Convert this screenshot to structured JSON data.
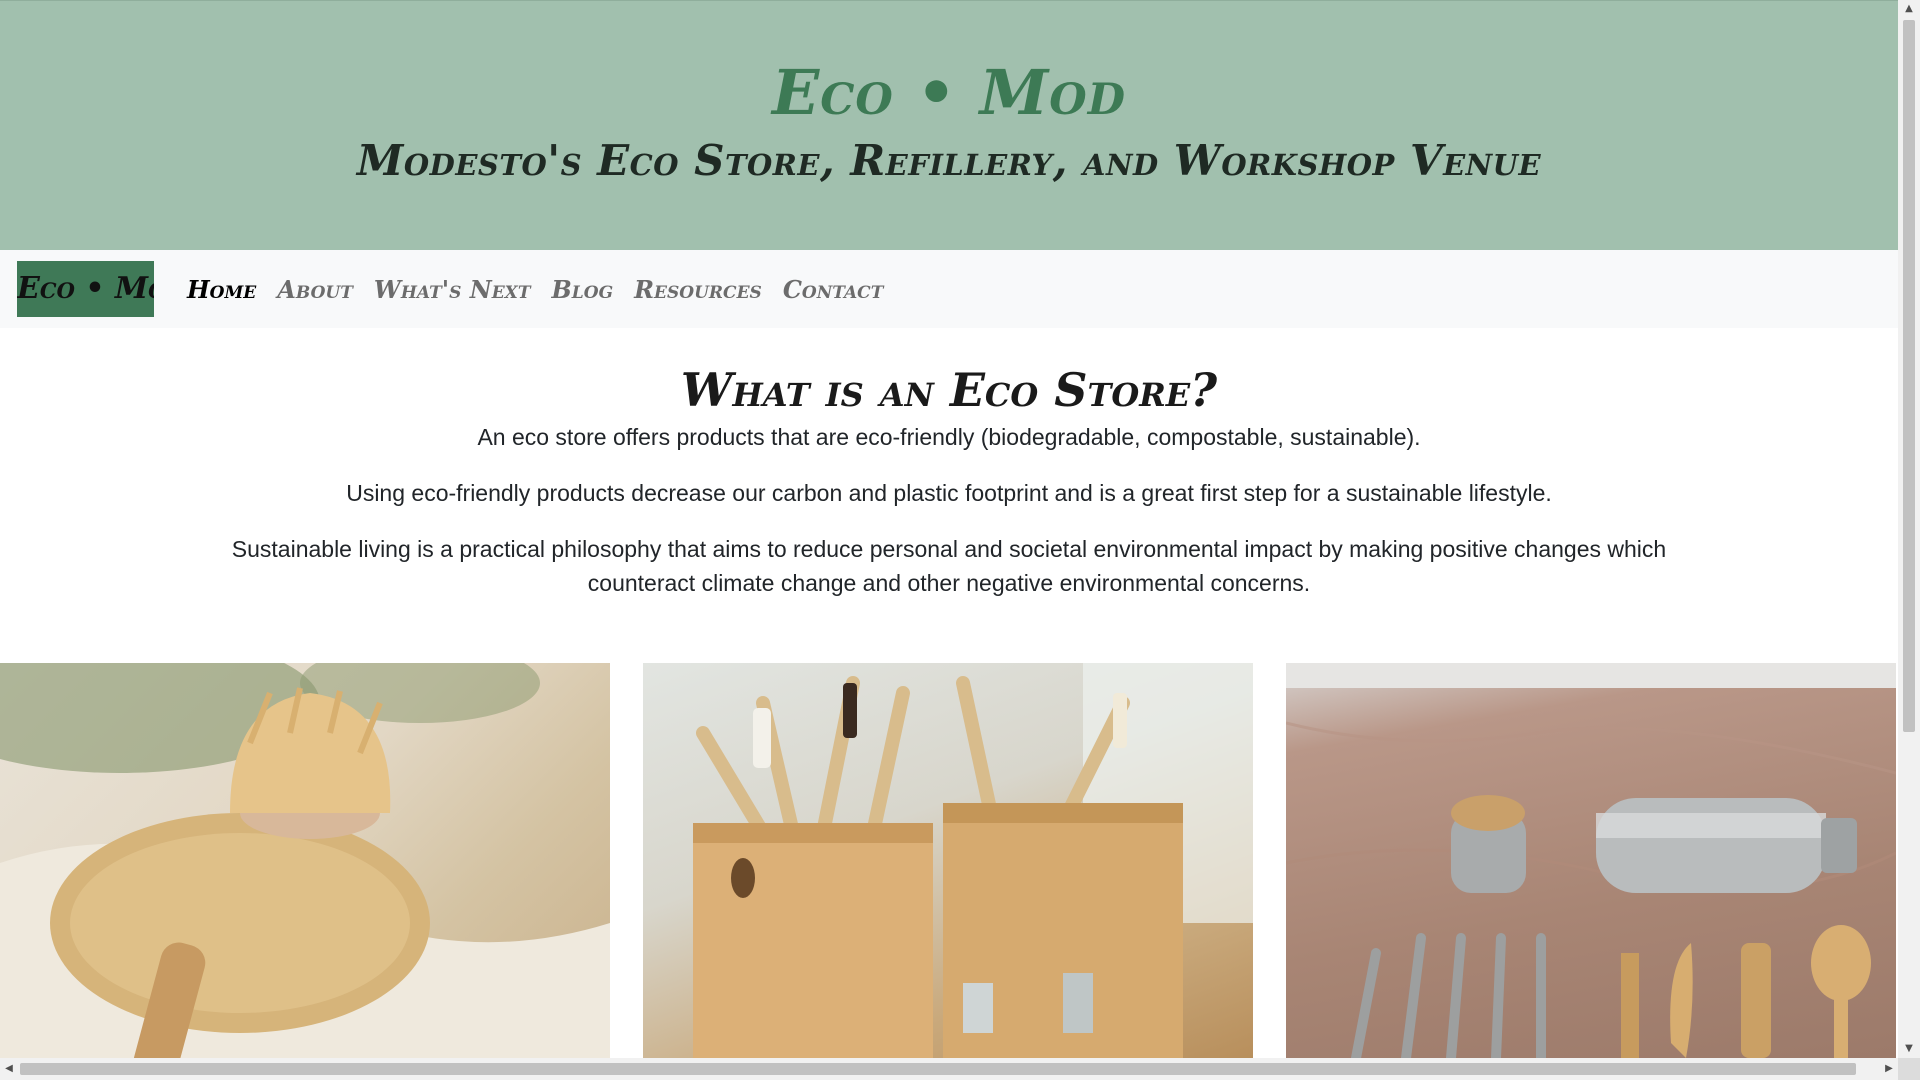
{
  "hero": {
    "title": "Eco • Mod",
    "subtitle": "Modesto's Eco Store, Refillery, and Workshop Venue"
  },
  "navbar": {
    "brand": "Eco • Mod",
    "links": [
      {
        "label": "Home",
        "active": true
      },
      {
        "label": "About"
      },
      {
        "label": "What's Next"
      },
      {
        "label": "Blog"
      },
      {
        "label": "Resources"
      },
      {
        "label": "Contact"
      }
    ]
  },
  "content": {
    "heading": "What is an Eco Store?",
    "paragraphs": [
      "An eco store offers products that are eco-friendly (biodegradable, compostable, sustainable).",
      "Using eco-friendly products decrease our carbon and plastic footprint and is a great first step for a sustainable lifestyle.",
      "Sustainable living is a practical philosophy that aims to reduce personal and societal environmental impact by making positive changes which counteract climate change and other negative environmental concerns."
    ]
  },
  "colors": {
    "hero_bg": "#a1c0ae",
    "hero_title": "#3d7a55",
    "brand_bg": "#3f7957",
    "navbar_bg": "#f8f9fa"
  },
  "gallery": {
    "images": [
      "dish-brush-and-loofah-photo",
      "bamboo-toothbrushes-photo",
      "steel-bottle-and-bamboo-cutlery-photo"
    ]
  }
}
